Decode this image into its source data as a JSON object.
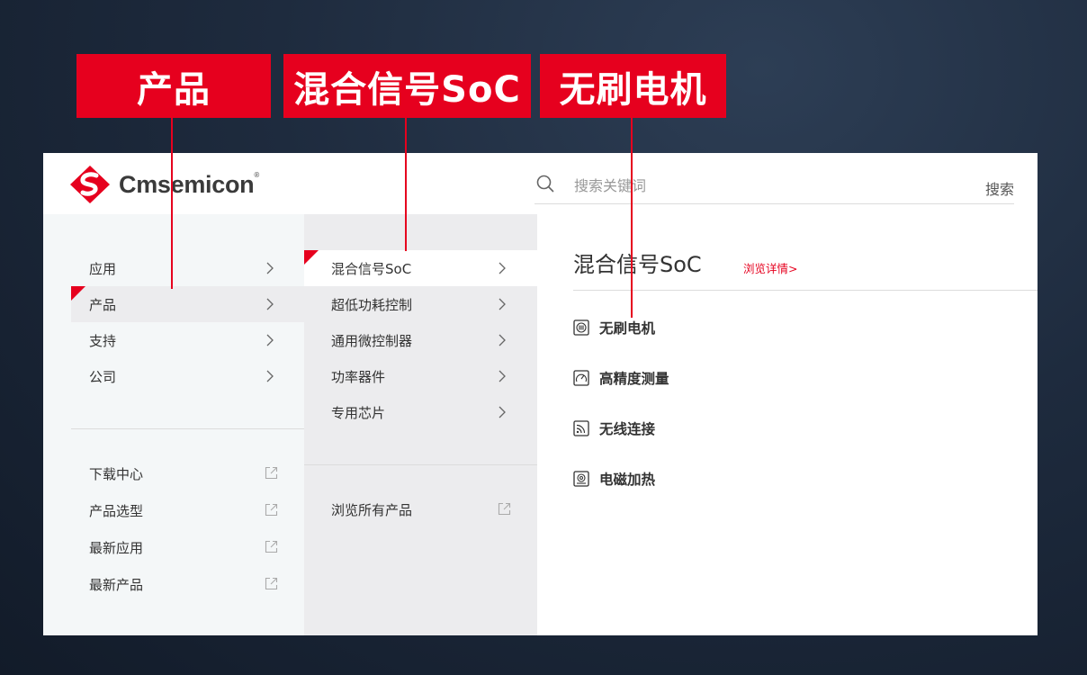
{
  "callouts": [
    "产品",
    "混合信号SoC",
    "无刷电机"
  ],
  "brand": {
    "name": "Cmsemicon",
    "reg": "®",
    "color": "#e6001e"
  },
  "search": {
    "placeholder": "搜索关键词",
    "button": "搜索"
  },
  "nav_primary": [
    {
      "label": "应用",
      "active": false
    },
    {
      "label": "产品",
      "active": true
    },
    {
      "label": "支持",
      "active": false
    },
    {
      "label": "公司",
      "active": false
    }
  ],
  "nav_links": [
    "下载中心",
    "产品选型",
    "最新应用",
    "最新产品"
  ],
  "nav_products": [
    {
      "label": "混合信号SoC",
      "active": true
    },
    {
      "label": "超低功耗控制",
      "active": false
    },
    {
      "label": "通用微控制器",
      "active": false
    },
    {
      "label": "功率器件",
      "active": false
    },
    {
      "label": "专用芯片",
      "active": false
    }
  ],
  "browse_all": "浏览所有产品",
  "detail": {
    "title": "混合信号SoC",
    "more": "浏览详情>",
    "items": [
      {
        "label": "无刷电机",
        "icon": "motor-icon"
      },
      {
        "label": "高精度测量",
        "icon": "gauge-icon"
      },
      {
        "label": "无线连接",
        "icon": "wireless-icon"
      },
      {
        "label": "电磁加热",
        "icon": "induction-heating-icon"
      }
    ]
  }
}
